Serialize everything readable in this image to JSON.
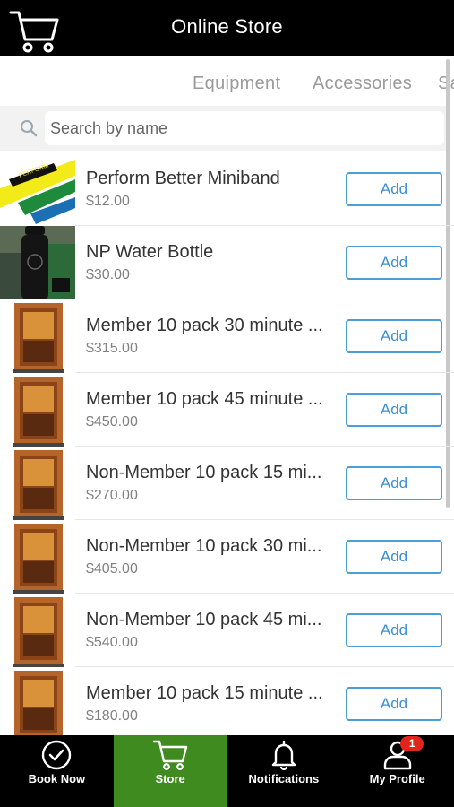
{
  "header": {
    "title": "Online Store",
    "cart_icon": "shopping-cart-icon"
  },
  "tabs": [
    "Equipment",
    "Accessories",
    "Sa"
  ],
  "search": {
    "placeholder": "Search by name",
    "value": ""
  },
  "colors": {
    "header_bg": "#000000",
    "accent_blue": "#3a8fd0",
    "active_nav": "#3f8b1f",
    "badge_red": "#e0261c"
  },
  "products": [
    {
      "name": "Perform Better Miniband",
      "price": "$12.00",
      "button": "Add",
      "image": "miniband"
    },
    {
      "name": "NP Water Bottle",
      "price": "$30.00",
      "button": "Add",
      "image": "bottle"
    },
    {
      "name": "Member 10 pack 30 minute ...",
      "price": "$315.00",
      "button": "Add",
      "image": "sauna"
    },
    {
      "name": "Member 10 pack 45 minute ...",
      "price": "$450.00",
      "button": "Add",
      "image": "sauna"
    },
    {
      "name": "Non-Member 10 pack 15 mi...",
      "price": "$270.00",
      "button": "Add",
      "image": "sauna"
    },
    {
      "name": "Non-Member 10 pack 30 mi...",
      "price": "$405.00",
      "button": "Add",
      "image": "sauna"
    },
    {
      "name": "Non-Member 10 pack 45 mi...",
      "price": "$540.00",
      "button": "Add",
      "image": "sauna"
    },
    {
      "name": "Member 10 pack 15 minute ...",
      "price": "$180.00",
      "button": "Add",
      "image": "sauna"
    }
  ],
  "bottom_nav": [
    {
      "label": "Book Now",
      "icon": "check-circle-icon"
    },
    {
      "label": "Store",
      "icon": "shopping-cart-icon"
    },
    {
      "label": "Notifications",
      "icon": "bell-icon"
    },
    {
      "label": "My Profile",
      "icon": "user-icon",
      "badge": "1"
    }
  ]
}
